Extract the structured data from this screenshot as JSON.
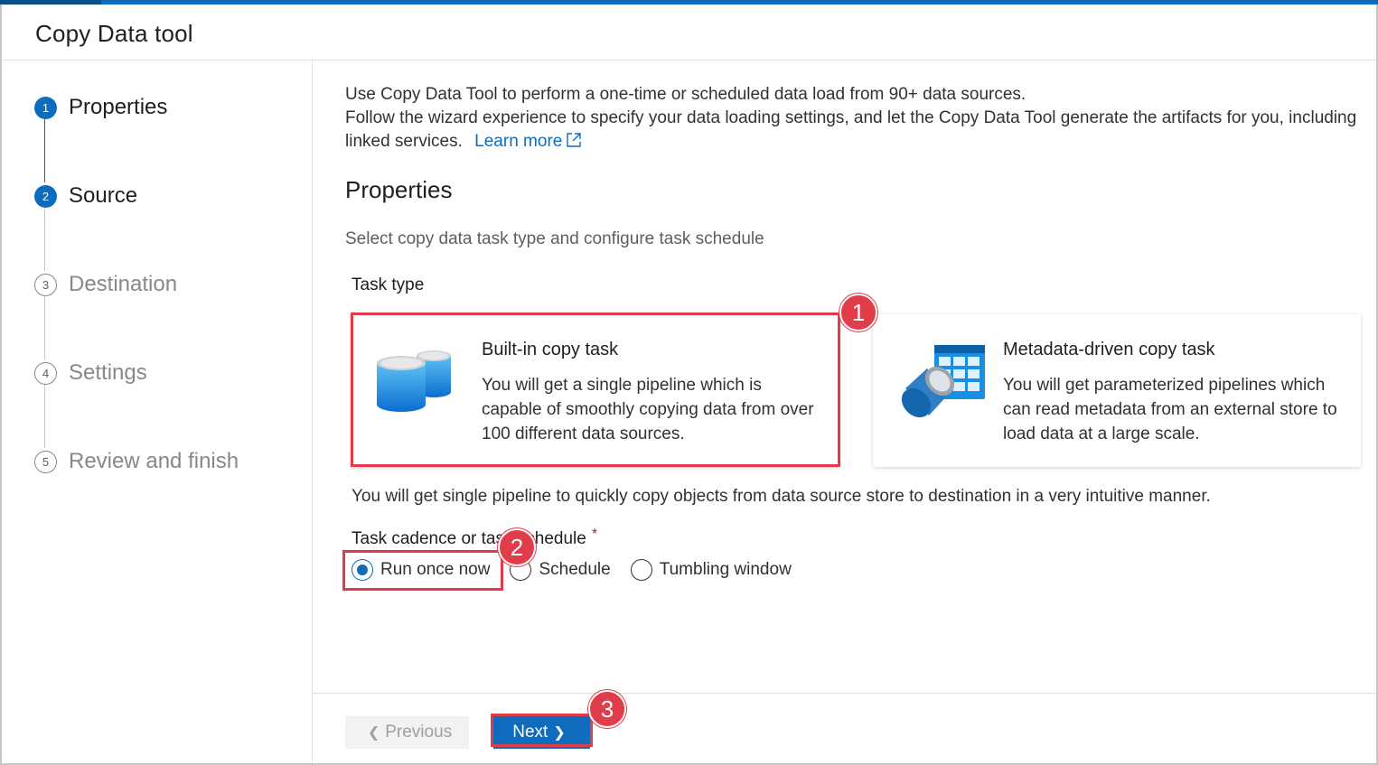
{
  "app": {
    "title": "Copy Data tool"
  },
  "sidebar": {
    "steps": [
      {
        "num": "1",
        "label": "Properties",
        "state": "active"
      },
      {
        "num": "2",
        "label": "Source",
        "state": "active"
      },
      {
        "num": "3",
        "label": "Destination",
        "state": "pending"
      },
      {
        "num": "4",
        "label": "Settings",
        "state": "pending"
      },
      {
        "num": "5",
        "label": "Review and finish",
        "state": "pending"
      }
    ]
  },
  "main": {
    "intro_line1": "Use Copy Data Tool to perform a one-time or scheduled data load from 90+ data sources.",
    "intro_line2": "Follow the wizard experience to specify your data loading settings, and let the Copy Data Tool generate the artifacts for you, including",
    "intro_line3": "linked services.",
    "learn_more": "Learn more",
    "section_title": "Properties",
    "section_desc": "Select copy data task type and configure task schedule",
    "task_type_label": "Task type",
    "cards": [
      {
        "title": "Built-in copy task",
        "desc": "You will get a single pipeline which is capable of smoothly copying data from over 100 different data sources.",
        "icon": "database-icon",
        "selected": true
      },
      {
        "title": "Metadata-driven copy task",
        "desc": "You will get parameterized pipelines which can read metadata from an external store to load data at a large scale.",
        "icon": "metadata-table-icon",
        "selected": false
      }
    ],
    "task_hint": "You will get single pipeline to quickly copy objects from data source store to destination in a very intuitive manner.",
    "cadence_label": "Task cadence or task schedule",
    "required_mark": "*",
    "cadence_options": [
      {
        "label": "Run once now",
        "checked": true
      },
      {
        "label": "Schedule",
        "checked": false
      },
      {
        "label": "Tumbling window",
        "checked": false
      }
    ]
  },
  "footer": {
    "previous_label": "Previous",
    "next_label": "Next"
  },
  "callouts": {
    "one": "1",
    "two": "2",
    "three": "3"
  },
  "colors": {
    "accent": "#0f6cbd",
    "callout": "#e03c4a"
  }
}
